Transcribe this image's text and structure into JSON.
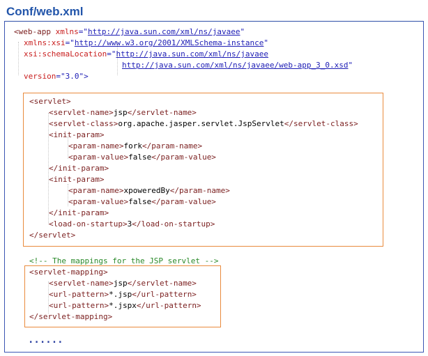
{
  "title": "Conf/web.xml",
  "header": {
    "l1_open": "<web-app ",
    "l1_attr": "xmlns",
    "l1_eq": "=\"",
    "l1_val": "http://java.sun.com/xml/ns/javaee",
    "l1_close": "\"",
    "l2_attr": "xmlns:xsi",
    "l2_eq": "=\"",
    "l2_val": "http://www.w3.org/2001/XMLSchema-instance",
    "l2_close": "\"",
    "l3_attr": "xsi:schemaLocation",
    "l3_eq": "=\"",
    "l3_val": "http://java.sun.com/xml/ns/javaee",
    "l4_val": "http://java.sun.com/xml/ns/javaee/web-app_3_0.xsd",
    "l4_close": "\"",
    "l5_attr": "version",
    "l5_eq": "=\"",
    "l5_val": "3.0",
    "l5_close": "\">"
  },
  "servlet": {
    "open": "<servlet>",
    "name_open": "<servlet-name>",
    "name": "jsp",
    "name_close": "</servlet-name>",
    "class_open": "<servlet-class>",
    "class": "org.apache.jasper.servlet.JspServlet",
    "class_close": "</servlet-class>",
    "ip1_open": "<init-param>",
    "p1n_open": "<param-name>",
    "p1n": "fork",
    "p1n_close": "</param-name>",
    "p1v_open": "<param-value>",
    "p1v": "false",
    "p1v_close": "</param-value>",
    "ip1_close": "</init-param>",
    "ip2_open": "<init-param>",
    "p2n_open": "<param-name>",
    "p2n": "xpoweredBy",
    "p2n_close": "</param-name>",
    "p2v_open": "<param-value>",
    "p2v": "false",
    "p2v_close": "</param-value>",
    "ip2_close": "</init-param>",
    "los_open": "<load-on-startup>",
    "los": "3",
    "los_close": "</load-on-startup>",
    "close": "</servlet>"
  },
  "comment": "<!-- The mappings for the JSP servlet -->",
  "mapping": {
    "open": "<servlet-mapping>",
    "name_open": "<servlet-name>",
    "name": "jsp",
    "name_close": "</servlet-name>",
    "u1_open": "<url-pattern>",
    "u1": "*.jsp",
    "u1_close": "</url-pattern>",
    "u2_open": "<url-pattern>",
    "u2": "*.jspx",
    "u2_close": "</url-pattern>",
    "close": "</servlet-mapping>"
  },
  "ellipsis": "......"
}
